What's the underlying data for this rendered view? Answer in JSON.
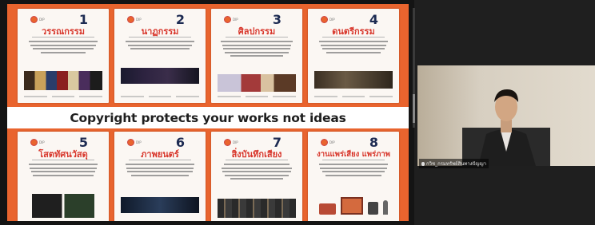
{
  "banner": "Copyright protects your works not ideas",
  "cards": [
    {
      "num": "1",
      "title": "วรรณกรรม"
    },
    {
      "num": "2",
      "title": "นาฏกรรม"
    },
    {
      "num": "3",
      "title": "ศิลปกรรม"
    },
    {
      "num": "4",
      "title": "ดนตรีกรรม"
    },
    {
      "num": "5",
      "title": "โสตทัศนวัสดุ"
    },
    {
      "num": "6",
      "title": "ภาพยนตร์"
    },
    {
      "num": "7",
      "title": "สิ่งบันทึกเสียง"
    },
    {
      "num": "8",
      "title": "งานแพร่เสียง แพร่ภาพ"
    }
  ],
  "participant": {
    "name": "กวิช_กรมทรัพย์สินทางปัญญา"
  },
  "colors": {
    "slide_bg": "#e9642e",
    "title_red": "#d8372c",
    "number_navy": "#1d2b52"
  }
}
